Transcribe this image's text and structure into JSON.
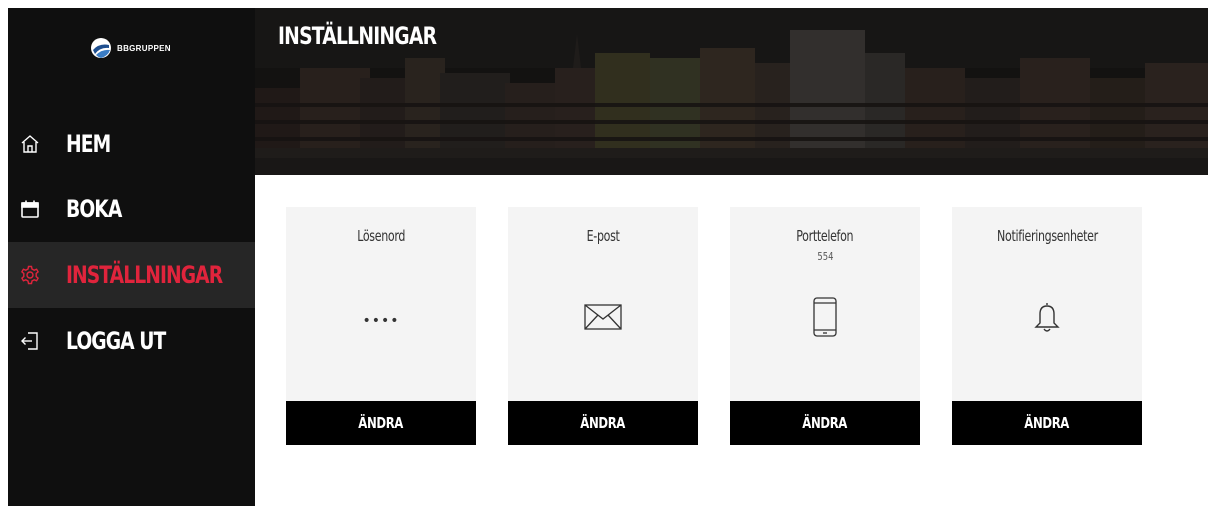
{
  "brand": {
    "name": "BBGRUPPEN",
    "icon": "bbgruppen-logo"
  },
  "sidebar": {
    "items": [
      {
        "label": "HEM",
        "icon": "home-icon",
        "active": false
      },
      {
        "label": "BOKA",
        "icon": "calendar-icon",
        "active": false
      },
      {
        "label": "INSTÄLLNINGAR",
        "icon": "gear-icon",
        "active": true
      },
      {
        "label": "LOGGA UT",
        "icon": "logout-icon",
        "active": false
      }
    ]
  },
  "header": {
    "title": "INSTÄLLNINGAR"
  },
  "cards": [
    {
      "title": "Lösenord",
      "subtitle": "",
      "icon": "password-dots",
      "value": "••••",
      "button": "ÄNDRA"
    },
    {
      "title": "E-post",
      "subtitle": "",
      "icon": "envelope-icon",
      "button": "ÄNDRA"
    },
    {
      "title": "Porttelefon",
      "subtitle": "554",
      "icon": "phone-icon",
      "button": "ÄNDRA"
    },
    {
      "title": "Notifieringsenheter",
      "subtitle": "",
      "icon": "bell-icon",
      "button": "ÄNDRA"
    }
  ],
  "colors": {
    "sidebar_bg": "#0f0f0f",
    "active_item_bg": "#262626",
    "accent": "#e0243c",
    "card_bg": "#f4f4f4",
    "button_bg": "#000000"
  }
}
